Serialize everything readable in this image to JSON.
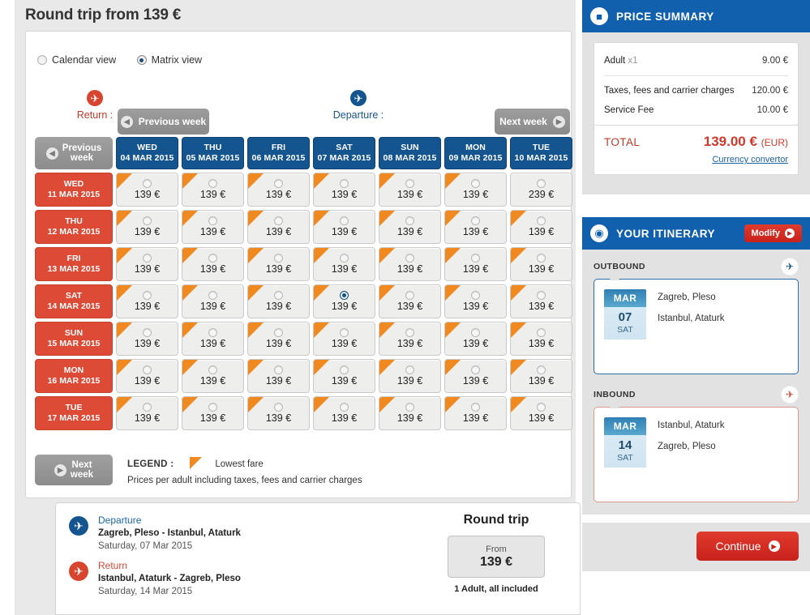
{
  "page": {
    "title": "Round trip from 139 €"
  },
  "view_toggle": {
    "calendar_label": "Calendar view",
    "matrix_label": "Matrix view",
    "selected": "matrix"
  },
  "axes": {
    "return_label": "Return :",
    "departure_label": "Departure :",
    "return_icon": "plane-landing-icon",
    "departure_icon": "plane-takeoff-icon"
  },
  "nav": {
    "previous_week": "Previous week",
    "next_week": "Next week",
    "previous_week_corner_l1": "Previous",
    "previous_week_corner_l2": "week",
    "next_week_corner_l1": "Next",
    "next_week_corner_l2": "week"
  },
  "matrix": {
    "columns": [
      {
        "dow": "WED",
        "date": "04 MAR 2015"
      },
      {
        "dow": "THU",
        "date": "05 MAR 2015"
      },
      {
        "dow": "FRI",
        "date": "06 MAR 2015"
      },
      {
        "dow": "SAT",
        "date": "07 MAR 2015"
      },
      {
        "dow": "SUN",
        "date": "08 MAR 2015"
      },
      {
        "dow": "MON",
        "date": "09 MAR 2015"
      },
      {
        "dow": "TUE",
        "date": "10 MAR 2015"
      }
    ],
    "rows": [
      {
        "dow": "WED",
        "date": "11 MAR 2015"
      },
      {
        "dow": "THU",
        "date": "12 MAR 2015"
      },
      {
        "dow": "FRI",
        "date": "13 MAR 2015"
      },
      {
        "dow": "SAT",
        "date": "14 MAR 2015"
      },
      {
        "dow": "SUN",
        "date": "15 MAR 2015"
      },
      {
        "dow": "MON",
        "date": "16 MAR 2015"
      },
      {
        "dow": "TUE",
        "date": "17 MAR 2015"
      }
    ],
    "cells": [
      [
        {
          "price": "139 €",
          "lowest": true,
          "selected": false
        },
        {
          "price": "139 €",
          "lowest": true,
          "selected": false
        },
        {
          "price": "139 €",
          "lowest": true,
          "selected": false
        },
        {
          "price": "139 €",
          "lowest": true,
          "selected": false
        },
        {
          "price": "139 €",
          "lowest": true,
          "selected": false
        },
        {
          "price": "139 €",
          "lowest": true,
          "selected": false
        },
        {
          "price": "239 €",
          "lowest": false,
          "selected": false
        }
      ],
      [
        {
          "price": "139 €",
          "lowest": true,
          "selected": false
        },
        {
          "price": "139 €",
          "lowest": true,
          "selected": false
        },
        {
          "price": "139 €",
          "lowest": true,
          "selected": false
        },
        {
          "price": "139 €",
          "lowest": true,
          "selected": false
        },
        {
          "price": "139 €",
          "lowest": true,
          "selected": false
        },
        {
          "price": "139 €",
          "lowest": true,
          "selected": false
        },
        {
          "price": "139 €",
          "lowest": true,
          "selected": false
        }
      ],
      [
        {
          "price": "139 €",
          "lowest": true,
          "selected": false
        },
        {
          "price": "139 €",
          "lowest": true,
          "selected": false
        },
        {
          "price": "139 €",
          "lowest": true,
          "selected": false
        },
        {
          "price": "139 €",
          "lowest": true,
          "selected": false
        },
        {
          "price": "139 €",
          "lowest": true,
          "selected": false
        },
        {
          "price": "139 €",
          "lowest": true,
          "selected": false
        },
        {
          "price": "139 €",
          "lowest": true,
          "selected": false
        }
      ],
      [
        {
          "price": "139 €",
          "lowest": true,
          "selected": false
        },
        {
          "price": "139 €",
          "lowest": true,
          "selected": false
        },
        {
          "price": "139 €",
          "lowest": true,
          "selected": false
        },
        {
          "price": "139 €",
          "lowest": true,
          "selected": true
        },
        {
          "price": "139 €",
          "lowest": true,
          "selected": false
        },
        {
          "price": "139 €",
          "lowest": true,
          "selected": false
        },
        {
          "price": "139 €",
          "lowest": true,
          "selected": false
        }
      ],
      [
        {
          "price": "139 €",
          "lowest": true,
          "selected": false
        },
        {
          "price": "139 €",
          "lowest": true,
          "selected": false
        },
        {
          "price": "139 €",
          "lowest": true,
          "selected": false
        },
        {
          "price": "139 €",
          "lowest": true,
          "selected": false
        },
        {
          "price": "139 €",
          "lowest": true,
          "selected": false
        },
        {
          "price": "139 €",
          "lowest": true,
          "selected": false
        },
        {
          "price": "139 €",
          "lowest": true,
          "selected": false
        }
      ],
      [
        {
          "price": "139 €",
          "lowest": true,
          "selected": false
        },
        {
          "price": "139 €",
          "lowest": true,
          "selected": false
        },
        {
          "price": "139 €",
          "lowest": true,
          "selected": false
        },
        {
          "price": "139 €",
          "lowest": true,
          "selected": false
        },
        {
          "price": "139 €",
          "lowest": true,
          "selected": false
        },
        {
          "price": "139 €",
          "lowest": true,
          "selected": false
        },
        {
          "price": "139 €",
          "lowest": true,
          "selected": false
        }
      ],
      [
        {
          "price": "139 €",
          "lowest": true,
          "selected": false
        },
        {
          "price": "139 €",
          "lowest": true,
          "selected": false
        },
        {
          "price": "139 €",
          "lowest": true,
          "selected": false
        },
        {
          "price": "139 €",
          "lowest": true,
          "selected": false
        },
        {
          "price": "139 €",
          "lowest": true,
          "selected": false
        },
        {
          "price": "139 €",
          "lowest": true,
          "selected": false
        },
        {
          "price": "139 €",
          "lowest": true,
          "selected": false
        }
      ]
    ]
  },
  "legend": {
    "label": "LEGEND :",
    "lowest_fare": "Lowest fare",
    "note": "Prices per adult including taxes, fees and carrier charges"
  },
  "summary": {
    "departure": {
      "title": "Departure",
      "route": "Zagreb, Pleso - Istanbul, Ataturk",
      "date": "Saturday, 07 Mar 2015"
    },
    "return": {
      "title": "Return",
      "route": "Istanbul, Ataturk - Zagreb, Pleso",
      "date": "Saturday, 14 Mar 2015"
    },
    "round_trip_title": "Round trip",
    "from_label": "From",
    "from_price": "139 €",
    "passenger_note": "1 Adult, all included"
  },
  "price_summary": {
    "title": "PRICE SUMMARY",
    "icon": "ticket-icon",
    "lines": [
      {
        "label": "Adult",
        "qty": "x1",
        "value": "9.00 €"
      }
    ],
    "lines2": [
      {
        "label": "Taxes, fees and carrier charges",
        "value": "120.00 €"
      },
      {
        "label": "Service Fee",
        "value": "10.00 €"
      }
    ],
    "total_label": "TOTAL",
    "total_value": "139.00 €",
    "total_currency": "(EUR)",
    "currency_convertor": "Currency convertor"
  },
  "itinerary": {
    "title": "YOUR ITINERARY",
    "icon": "globe-icon",
    "modify_label": "Modify",
    "outbound": {
      "section_label": "OUTBOUND",
      "icon": "plane-takeoff-icon",
      "month": "MAR",
      "day": "07",
      "dow": "SAT",
      "from": "Zagreb, Pleso",
      "to": "Istanbul, Ataturk"
    },
    "inbound": {
      "section_label": "INBOUND",
      "icon": "plane-landing-icon",
      "month": "MAR",
      "day": "14",
      "dow": "SAT",
      "from": "Istanbul, Ataturk",
      "to": "Zagreb, Pleso"
    }
  },
  "actions": {
    "continue_label": "Continue"
  },
  "colors": {
    "brand_blue": "#15558f",
    "header_blue": "#1060ad",
    "brand_red": "#dd4b36",
    "accent_red": "#c8211b",
    "lowest_orange": "#f08a20",
    "panel_gray": "#e2e2e2",
    "page_gray": "#e9e9e9"
  }
}
